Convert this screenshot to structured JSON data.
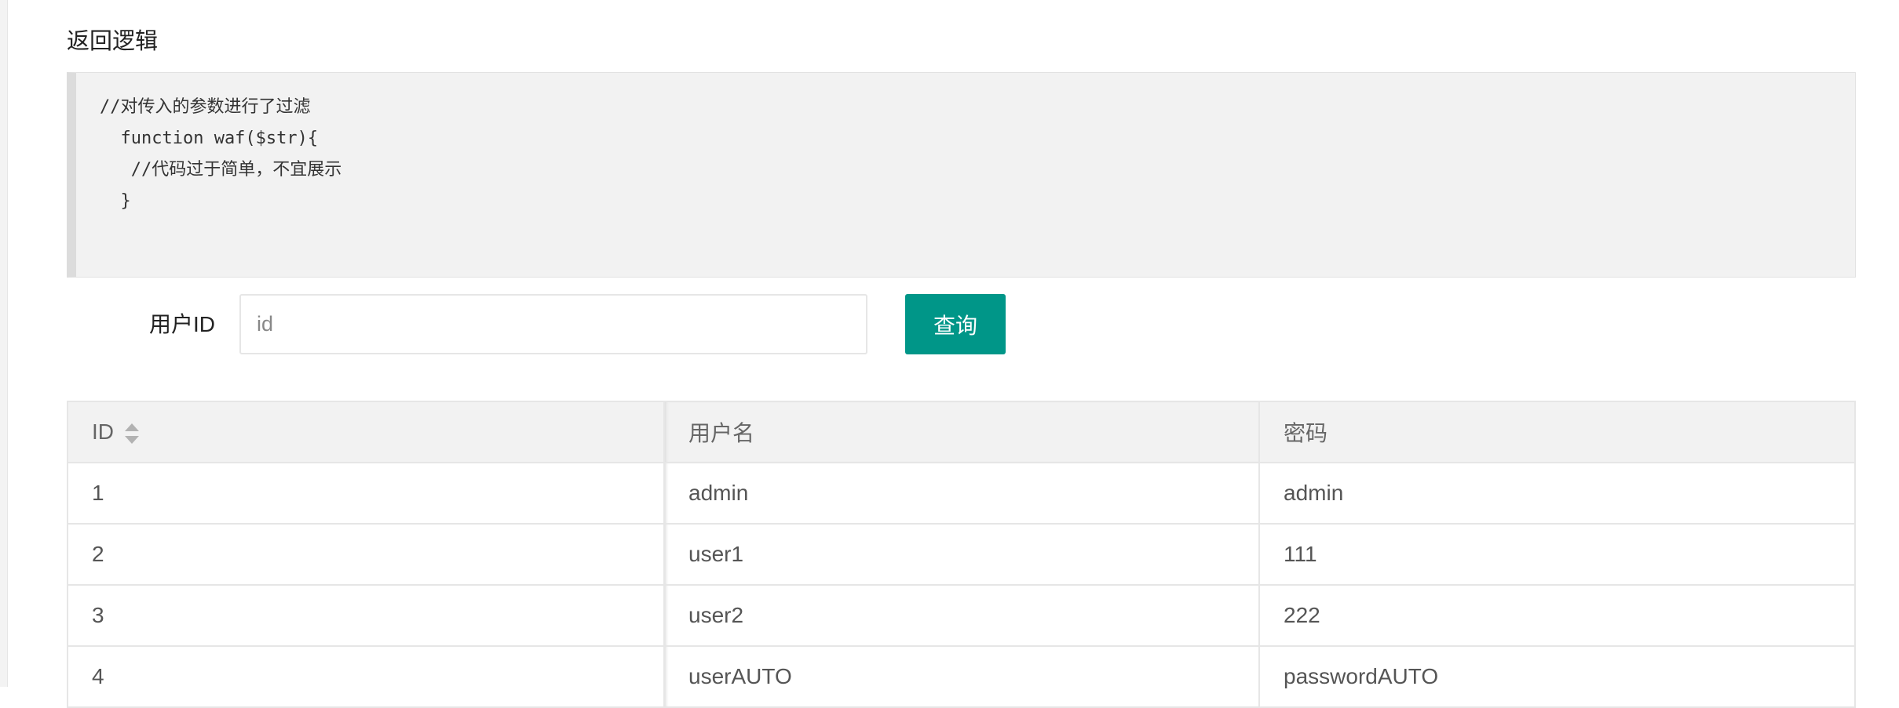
{
  "section": {
    "title": "返回逻辑"
  },
  "code": {
    "lines": [
      "//对传入的参数进行了过滤",
      "  function waf($str){",
      "   //代码过于简单，不宜展示",
      "  }"
    ]
  },
  "form": {
    "label": "用户ID",
    "input_placeholder": "id",
    "input_value": "",
    "button_label": "查询",
    "button_color": "#009688"
  },
  "table": {
    "columns": [
      "ID",
      "用户名",
      "密码"
    ],
    "sortable_icon": "sort-icon",
    "rows": [
      [
        "1",
        "admin",
        "admin"
      ],
      [
        "2",
        "user1",
        "111"
      ],
      [
        "3",
        "user2",
        "222"
      ],
      [
        "4",
        "userAUTO",
        "passwordAUTO"
      ]
    ]
  }
}
